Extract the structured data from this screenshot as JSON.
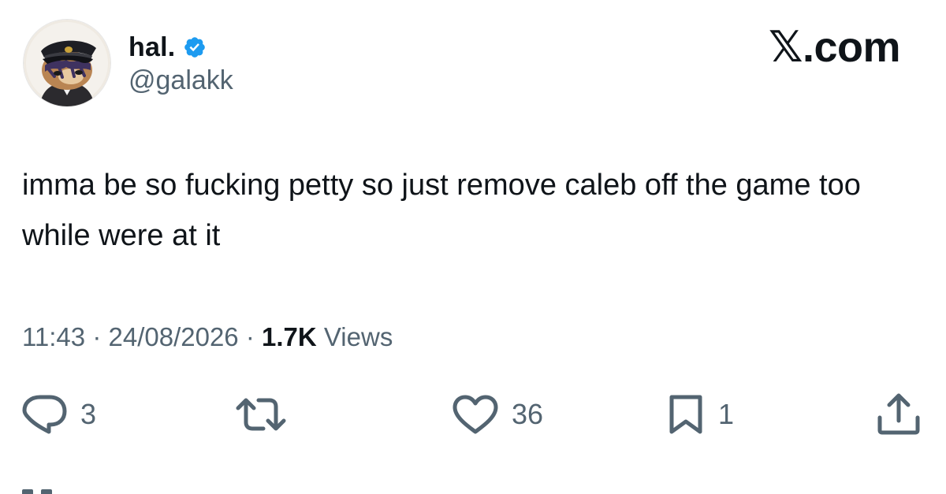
{
  "author": {
    "display_name": "hal.",
    "handle": "@galakk",
    "verified": true,
    "avatar": "cartoon-cat-in-captain-hat"
  },
  "site": {
    "glyph": "𝕏",
    "suffix": ".com"
  },
  "tweet": {
    "text": "imma be so fucking petty so just remove caleb off the game too while were at it"
  },
  "meta": {
    "time": "11:43",
    "separator": "·",
    "date": "24/08/2026",
    "views_count": "1.7K",
    "views_label": "Views"
  },
  "actions": {
    "replies": "3",
    "reposts": "",
    "likes": "36",
    "bookmarks": "1"
  },
  "icons": {
    "reply": "reply-icon",
    "repost": "repost-icon",
    "like": "heart-icon",
    "bookmark": "bookmark-icon",
    "share": "share-icon",
    "verified": "verified-badge-icon"
  },
  "colors": {
    "text": "#0f1419",
    "secondary": "#536471",
    "verified": "#1d9bf0"
  }
}
